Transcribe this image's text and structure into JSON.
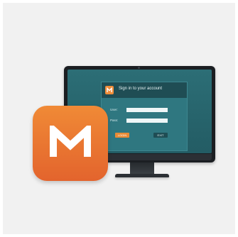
{
  "app": {
    "name": "M",
    "brand_color": "#ee7b33"
  },
  "signin": {
    "title": "Sign in to your account",
    "user_label": "User:",
    "pass_label": "Pass:",
    "login_label": "LOGIN",
    "exit_label": "EXIT"
  },
  "colors": {
    "screen": "#2c6e76",
    "panel_header": "#1f4d54",
    "button_login": "#e88b36"
  },
  "icons": {
    "app_icon": "m-logo-icon",
    "mini_logo": "m-logo-icon"
  }
}
